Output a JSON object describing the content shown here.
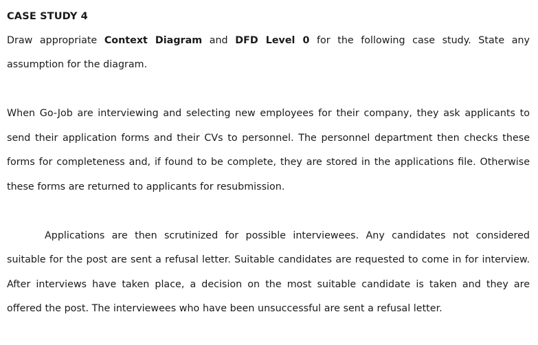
{
  "document": {
    "heading": "CASE STUDY 4",
    "text_color": "#1a1a1a",
    "background_color": "#ffffff",
    "instruction": {
      "before_bold_1": "Draw appropriate ",
      "bold_1": "Context Diagram",
      "between_bolds": " and ",
      "bold_2": "DFD Level 0",
      "after_bold_2": " for the following case study. State any assumption for the diagram."
    },
    "paragraphs": [
      {
        "id": "para-scenario-1",
        "indent": false,
        "text": "When Go-Job are interviewing and selecting new employees for their company, they ask applicants to send their application forms and their CVs to personnel. The personnel department then checks these forms for completeness and, if found to be complete, they are stored in the applications file. Otherwise these forms are returned to applicants for resubmission."
      },
      {
        "id": "para-scenario-2",
        "indent": true,
        "text": "Applications are then scrutinized for possible interviewees. Any candidates not considered suitable for the post are sent a refusal letter. Suitable candidates are requested to come in for interview. After interviews have taken place, a decision on the most suitable candidate is taken and they are offered the post. The interviewees who have been unsuccessful are sent a refusal letter."
      }
    ]
  }
}
